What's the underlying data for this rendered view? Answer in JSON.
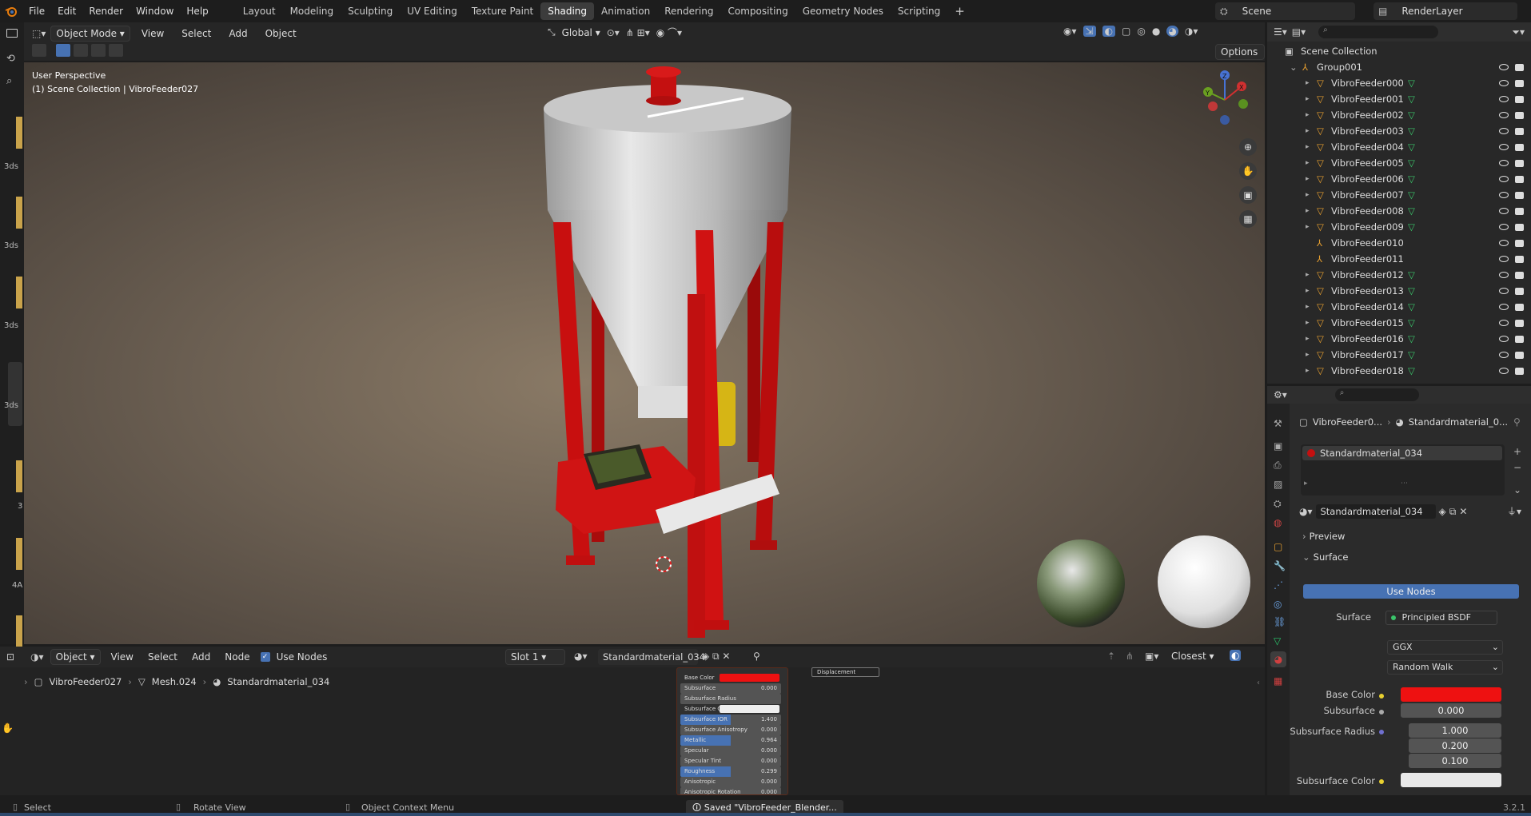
{
  "topbar": {
    "menus": [
      "File",
      "Edit",
      "Render",
      "Window",
      "Help"
    ],
    "workspaces": [
      "Layout",
      "Modeling",
      "Sculpting",
      "UV Editing",
      "Texture Paint",
      "Shading",
      "Animation",
      "Rendering",
      "Compositing",
      "Geometry Nodes",
      "Scripting"
    ],
    "active_workspace": "Shading",
    "add_tab": "+",
    "scene": "Scene",
    "render_layer": "RenderLayer"
  },
  "viewport": {
    "mode": "Object Mode",
    "menus": [
      "View",
      "Select",
      "Add",
      "Object"
    ],
    "orientation": "Global",
    "options": "Options",
    "info_line1": "User Perspective",
    "info_line2": "(1) Scene Collection | VibroFeeder027",
    "accent_red": "#cc1111"
  },
  "left_strip": {
    "labels": [
      "3ds",
      "3ds",
      "3ds",
      "3ds",
      "3",
      "4A"
    ]
  },
  "outliner": {
    "root": "Scene Collection",
    "group": "Group001",
    "items": [
      "VibroFeeder000",
      "VibroFeeder001",
      "VibroFeeder002",
      "VibroFeeder003",
      "VibroFeeder004",
      "VibroFeeder005",
      "VibroFeeder006",
      "VibroFeeder007",
      "VibroFeeder008",
      "VibroFeeder009",
      "VibroFeeder010",
      "VibroFeeder011",
      "VibroFeeder012",
      "VibroFeeder013",
      "VibroFeeder014",
      "VibroFeeder015",
      "VibroFeeder016",
      "VibroFeeder017",
      "VibroFeeder018"
    ]
  },
  "properties": {
    "breadcrumb_obj": "VibroFeeder0...",
    "breadcrumb_mat": "Standardmaterial_0...",
    "slot_name": "Standardmaterial_034",
    "material_name": "Standardmaterial_034",
    "preview": "Preview",
    "surface_panel": "Surface",
    "use_nodes": "Use Nodes",
    "surface_label": "Surface",
    "surface_value": "Principled BSDF",
    "distribution": "GGX",
    "subsurface_method": "Random Walk",
    "base_color_label": "Base Color",
    "base_color": "#ee1111",
    "subsurface_label": "Subsurface",
    "subsurface_value": "0.000",
    "subsurface_radius_label": "Subsurface Radius",
    "radius": [
      "1.000",
      "0.200",
      "0.100"
    ],
    "subsurface_color_label": "Subsurface Color"
  },
  "node_editor": {
    "type": "Object",
    "menus": [
      "View",
      "Select",
      "Add",
      "Node"
    ],
    "use_nodes": "Use Nodes",
    "slot": "Slot 1",
    "material": "Standardmaterial_034",
    "interp": "Closest",
    "breadcrumb": [
      "VibroFeeder027",
      "Mesh.024",
      "Standardmaterial_034"
    ],
    "node_rows": [
      [
        "Base Color",
        ""
      ],
      [
        "Subsurface",
        "0.000"
      ],
      [
        "Subsurface Radius",
        ""
      ],
      [
        "Subsurface Color",
        ""
      ],
      [
        "Subsurface IOR",
        "1.400"
      ],
      [
        "Subsurface Anisotropy",
        "0.000"
      ],
      [
        "Metallic",
        "0.964"
      ],
      [
        "Specular",
        "0.000"
      ],
      [
        "Specular Tint",
        "0.000"
      ],
      [
        "Roughness",
        "0.299"
      ],
      [
        "Anisotropic",
        "0.000"
      ],
      [
        "Anisotropic Rotation",
        "0.000"
      ]
    ],
    "displacement": "Displacement"
  },
  "status": {
    "select": "Select",
    "rotate": "Rotate View",
    "context": "Object Context Menu",
    "saved": "Saved \"VibroFeeder_Blender...",
    "version": "3.2.1"
  }
}
